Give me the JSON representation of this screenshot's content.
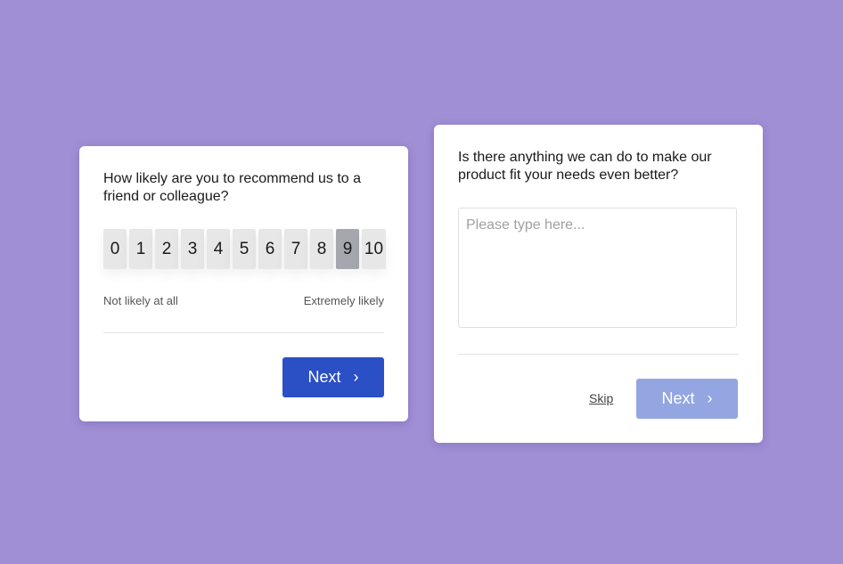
{
  "nps_card": {
    "question": "How likely are you to recommend us to a friend or colleague?",
    "scale": [
      "0",
      "1",
      "2",
      "3",
      "4",
      "5",
      "6",
      "7",
      "8",
      "9",
      "10"
    ],
    "selected_value": "9",
    "label_low": "Not likely at all",
    "label_high": "Extremely likely",
    "next_label": "Next",
    "next_icon": "chevron-right-icon"
  },
  "feedback_card": {
    "question": "Is there anything we can do to make our product fit your needs even better?",
    "input_value": "",
    "input_placeholder": "Please type here...",
    "skip_label": "Skip",
    "next_label": "Next",
    "next_icon": "chevron-right-icon"
  },
  "colors": {
    "background": "#a18fd6",
    "primary_button": "#2b4fc4",
    "disabled_button": "#93a6e1",
    "selected_score": "#a6a7ae"
  }
}
